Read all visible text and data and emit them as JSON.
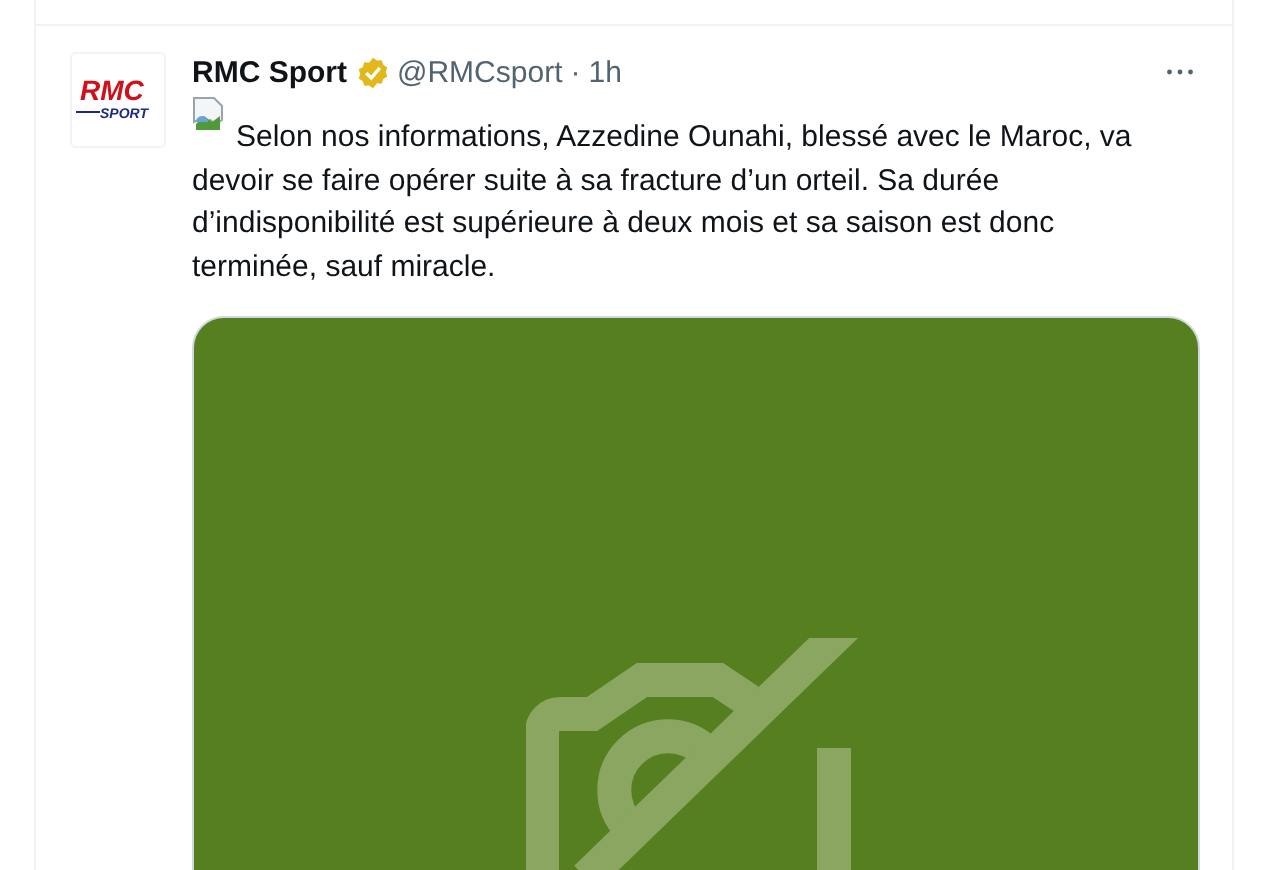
{
  "tweet": {
    "logo": {
      "top": "RMC",
      "bottom": "SPORT"
    },
    "author": "RMC Sport",
    "handle": "@RMCsport",
    "separator": "·",
    "time": "1h",
    "verified": true,
    "text": "Selon nos informations, Azzedine Ounahi, blessé avec le Maroc, va devoir se faire opérer suite à sa fracture d’un orteil. Sa durée d’indisponibilité est supérieure à deux mois et sa saison est donc terminée, sauf miracle.",
    "media": {
      "kind": "unavailable",
      "color": "#567f1f"
    }
  }
}
